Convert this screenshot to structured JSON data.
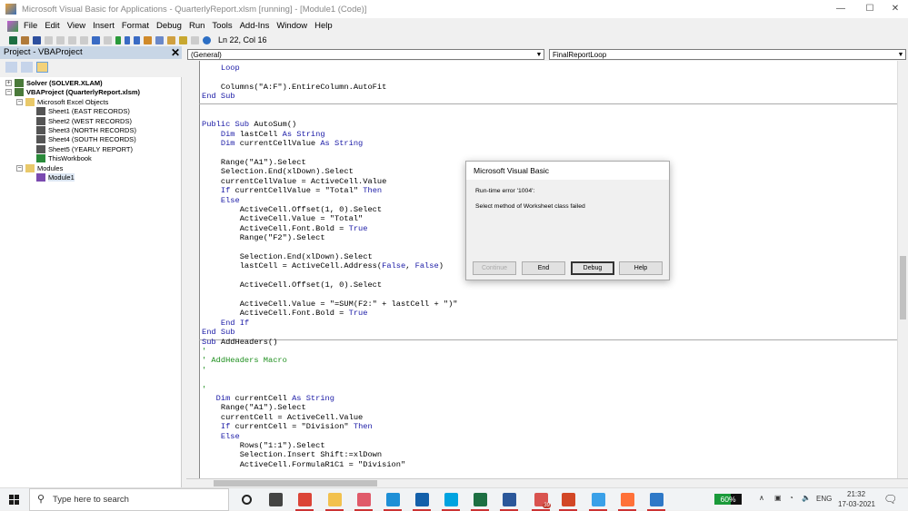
{
  "window": {
    "title": "Microsoft Visual Basic for Applications - QuarterlyReport.xlsm [running] - [Module1 (Code)]",
    "minimize": "—",
    "maximize": "☐",
    "close": "✕"
  },
  "menu": [
    "File",
    "Edit",
    "View",
    "Insert",
    "Format",
    "Debug",
    "Run",
    "Tools",
    "Add-Ins",
    "Window",
    "Help"
  ],
  "toolbar": {
    "cursor_position": "Ln 22, Col 16"
  },
  "project": {
    "title": "Project - VBAProject",
    "close": "✕",
    "tree": [
      {
        "label": "Solver (SOLVER.XLAM)",
        "level": 0,
        "bold": true,
        "expander": "+",
        "icon": "vba-project-icon"
      },
      {
        "label": "VBAProject (QuarterlyReport.xlsm)",
        "level": 0,
        "bold": true,
        "expander": "−",
        "icon": "vba-project-icon"
      },
      {
        "label": "Microsoft Excel Objects",
        "level": 1,
        "expander": "−",
        "icon": "folder-icon"
      },
      {
        "label": "Sheet1 (EAST RECORDS)",
        "level": 2,
        "icon": "sheet-icon"
      },
      {
        "label": "Sheet2 (WEST RECORDS)",
        "level": 2,
        "icon": "sheet-icon"
      },
      {
        "label": "Sheet3 (NORTH RECORDS)",
        "level": 2,
        "icon": "sheet-icon"
      },
      {
        "label": "Sheet4 (SOUTH RECORDS)",
        "level": 2,
        "icon": "sheet-icon"
      },
      {
        "label": "Sheet5 (YEARLY REPORT)",
        "level": 2,
        "icon": "sheet-icon"
      },
      {
        "label": "ThisWorkbook",
        "level": 2,
        "icon": "workbook-icon"
      },
      {
        "label": "Modules",
        "level": 1,
        "expander": "−",
        "icon": "folder-icon"
      },
      {
        "label": "Module1",
        "level": 2,
        "icon": "module-icon"
      }
    ]
  },
  "code_pane": {
    "object_combo": "(General)",
    "procedure_combo": "FinalReportLoop",
    "lines": [
      [
        [
          "    "
        ],
        [
          "Loop",
          "kw"
        ]
      ],
      [],
      [
        [
          "    Columns(\"A:F\").EntireColumn.AutoFit"
        ]
      ],
      [
        [
          "End Sub",
          "kw"
        ]
      ],
      "SEP",
      [],
      [],
      [
        [
          "Public Sub",
          "kw"
        ],
        [
          " AutoSum()"
        ]
      ],
      [
        [
          "    "
        ],
        [
          "Dim",
          "kw"
        ],
        [
          " lastCell "
        ],
        [
          "As String",
          "kw"
        ]
      ],
      [
        [
          "    "
        ],
        [
          "Dim",
          "kw"
        ],
        [
          " currentCellValue "
        ],
        [
          "As String",
          "kw"
        ]
      ],
      [],
      [
        [
          "    Range(\"A1\").Select"
        ]
      ],
      [
        [
          "    Selection.End(xlDown).Select"
        ]
      ],
      [
        [
          "    currentCellValue = ActiveCell.Value"
        ]
      ],
      [
        [
          "    "
        ],
        [
          "If",
          "kw"
        ],
        [
          " currentCellValue = \"Total\" "
        ],
        [
          "Then",
          "kw"
        ]
      ],
      [
        [
          "    "
        ],
        [
          "Else",
          "kw"
        ]
      ],
      [
        [
          "        ActiveCell.Offset(1, 0).Select"
        ]
      ],
      [
        [
          "        ActiveCell.Value = \"Total\""
        ]
      ],
      [
        [
          "        ActiveCell.Font.Bold = "
        ],
        [
          "True",
          "kw"
        ]
      ],
      [
        [
          "        Range(\"F2\").Select"
        ]
      ],
      [],
      [
        [
          "        Selection.End(xlDown).Select"
        ]
      ],
      [
        [
          "        lastCell = ActiveCell.Address("
        ],
        [
          "False",
          "kw"
        ],
        [
          ", "
        ],
        [
          "False",
          "kw"
        ],
        [
          ")"
        ]
      ],
      [],
      [
        [
          "        ActiveCell.Offset(1, 0).Select"
        ]
      ],
      [],
      [
        [
          "        ActiveCell.Value = \"=SUM(F2:\" + lastCell + \")\""
        ]
      ],
      [
        [
          "        ActiveCell.Font.Bold = "
        ],
        [
          "True",
          "kw"
        ]
      ],
      [
        [
          "    "
        ],
        [
          "End If",
          "kw"
        ]
      ],
      [
        [
          "End Sub",
          "kw"
        ]
      ],
      "SEP",
      [
        [
          "Sub",
          "kw"
        ],
        [
          " AddHeaders()"
        ]
      ],
      [
        [
          "'",
          "cm"
        ]
      ],
      [
        [
          "' AddHeaders Macro",
          "cm"
        ]
      ],
      [
        [
          "'",
          "cm"
        ]
      ],
      [],
      [
        [
          "'",
          "cm"
        ]
      ],
      [
        [
          "   "
        ],
        [
          "Dim",
          "kw"
        ],
        [
          " currentCell "
        ],
        [
          "As String",
          "kw"
        ]
      ],
      [
        [
          "    Range(\"A1\").Select"
        ]
      ],
      [
        [
          "    currentCell = ActiveCell.Value"
        ]
      ],
      [
        [
          "    "
        ],
        [
          "If",
          "kw"
        ],
        [
          " currentCell = \"Division\" "
        ],
        [
          "Then",
          "kw"
        ]
      ],
      [
        [
          "    "
        ],
        [
          "Else",
          "kw"
        ]
      ],
      [
        [
          "        Rows(\"1:1\").Select"
        ]
      ],
      [
        [
          "        Selection.Insert Shift:=xlDown"
        ]
      ],
      [
        [
          "        ActiveCell.FormulaR1C1 = \"Division\""
        ]
      ]
    ]
  },
  "dialog": {
    "title": "Microsoft Visual Basic",
    "error": "Run-time error '1004':",
    "message": "Select method of Worksheet class failed",
    "buttons": {
      "continue": "Continue",
      "end": "End",
      "debug": "Debug",
      "help": "Help"
    }
  },
  "taskbar": {
    "search_placeholder": "Type here to search",
    "battery": "60%",
    "language": "ENG",
    "time": "21:32",
    "date": "17-03-2021",
    "mail_badge": "39",
    "apps": [
      {
        "name": "cortana",
        "color": "#222"
      },
      {
        "name": "task-view",
        "color": "#444"
      },
      {
        "name": "chrome",
        "color": "#db4437"
      },
      {
        "name": "file-explorer",
        "color": "#f2c14e"
      },
      {
        "name": "snipping-tool",
        "color": "#e05a6a"
      },
      {
        "name": "edge",
        "color": "#1e8fd6"
      },
      {
        "name": "mail",
        "color": "#1460aa"
      },
      {
        "name": "lync",
        "color": "#00a3e0"
      },
      {
        "name": "excel",
        "color": "#1d6f42"
      },
      {
        "name": "word",
        "color": "#2b579a"
      },
      {
        "name": "outlook-badge",
        "color": "#d9534f"
      },
      {
        "name": "powerpoint",
        "color": "#d24726"
      },
      {
        "name": "phone",
        "color": "#3aa0e8"
      },
      {
        "name": "firefox",
        "color": "#ff7139"
      },
      {
        "name": "photos",
        "color": "#2e78c7"
      }
    ]
  }
}
